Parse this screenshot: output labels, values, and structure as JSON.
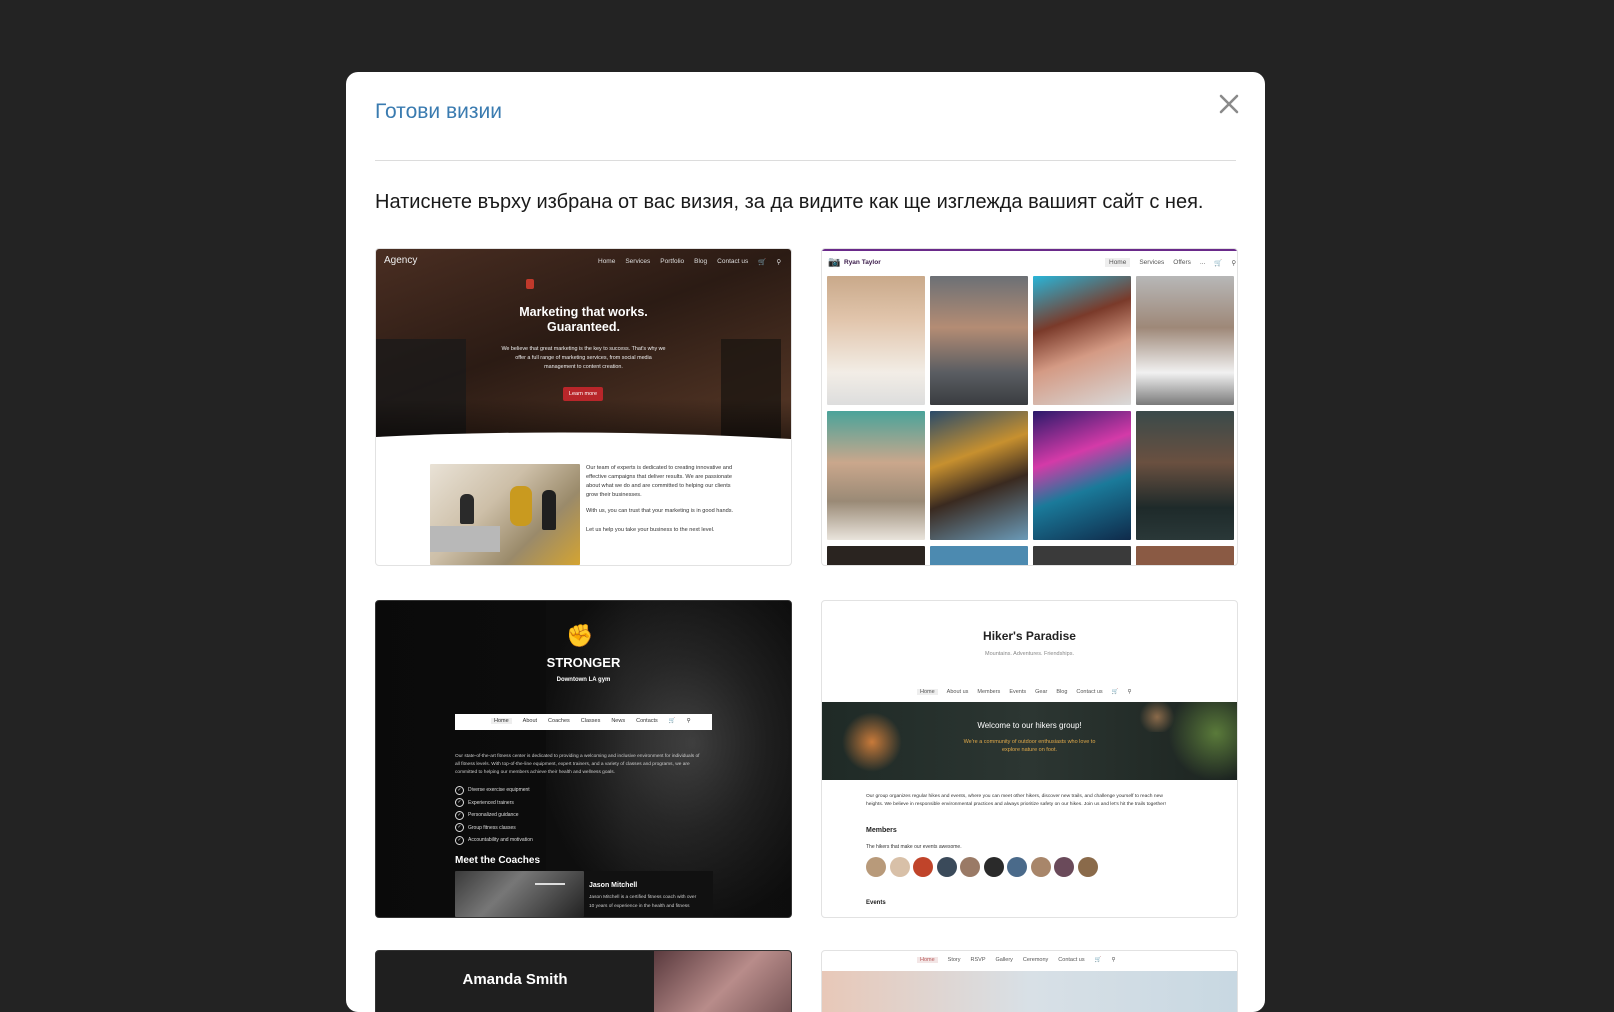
{
  "modal": {
    "title": "Готови визии",
    "instruction": "Натиснете върху избрана от вас визия, за да видите как ще изглежда вашият сайт с нея."
  },
  "themes": {
    "agency": {
      "logo": "Agency",
      "nav": [
        "Home",
        "Services",
        "Portfolio",
        "Blog",
        "Contact us"
      ],
      "headline1": "Marketing that works.",
      "headline2": "Guaranteed.",
      "sub1": "We believe that great marketing is the key to success. That's why we",
      "sub2": "offer a full range of marketing services, from social media",
      "sub3": "management to content creation.",
      "cta": "Learn more",
      "p1": "Our team of experts is dedicated to creating innovative and",
      "p2": "effective campaigns that deliver results. We are passionate",
      "p3": "about what we do and are committed to helping our clients",
      "p4": "grow their businesses.",
      "p5": "With us, you can trust that your marketing is in good hands.",
      "p6": "Let us help you take your business to the next level."
    },
    "photographer": {
      "name": "Ryan Taylor",
      "nav": [
        "Home",
        "Services",
        "Offers",
        "..."
      ]
    },
    "gym": {
      "brand": "STRONGER",
      "tagline": "Downtown LA gym",
      "nav": [
        "Home",
        "About",
        "Coaches",
        "Classes",
        "News",
        "Contacts"
      ],
      "intro1": "Our state-of-the-art fitness center is dedicated to providing a welcoming and inclusive environment for individuals of",
      "intro2": "all fitness levels. With top-of-the-line equipment, expert trainers, and a variety of classes and programs, we are",
      "intro3": "committed to helping our members achieve their health and wellness goals.",
      "features": [
        "Diverse exercise equipment",
        "Experienced trainers",
        "Personalized guidance",
        "Group fitness classes",
        "Accountability and motivation"
      ],
      "coaches_title": "Meet the Coaches",
      "coach_name": "Jason Mitchell",
      "coach_bio1": "Jason Mitchell is a certified fitness coach with over",
      "coach_bio2": "10 years of experience in the health and fitness"
    },
    "hikers": {
      "title": "Hiker's Paradise",
      "subtitle": "Mountains. Adventures. Friendships.",
      "nav": [
        "Home",
        "About us",
        "Members",
        "Events",
        "Gear",
        "Blog",
        "Contact us"
      ],
      "banner_title": "Welcome to our hikers group!",
      "banner_text1": "We're a community of outdoor enthusiasts who love to",
      "banner_text2": "explore nature on foot.",
      "para1": "Our group organizes regular hikes and events, where you can meet other hikers, discover new trails, and challenge yourself to reach new",
      "para2": "heights. We believe in responsible environmental practices and always prioritize safety on our hikes. Join us and let's hit the trails together!",
      "members_title": "Members",
      "members_text": "The hikers that make our events awesome.",
      "events_title": "Events"
    },
    "singer": {
      "name": "Amanda Smith"
    },
    "wedding": {
      "nav": [
        "Home",
        "Story",
        "RSVP",
        "Gallery",
        "Ceremony",
        "Contact us"
      ]
    }
  },
  "colors": {
    "title_blue": "#3a7bb0",
    "agency_cta": "#b8262a",
    "photographer_accent": "#6a2a8a"
  }
}
